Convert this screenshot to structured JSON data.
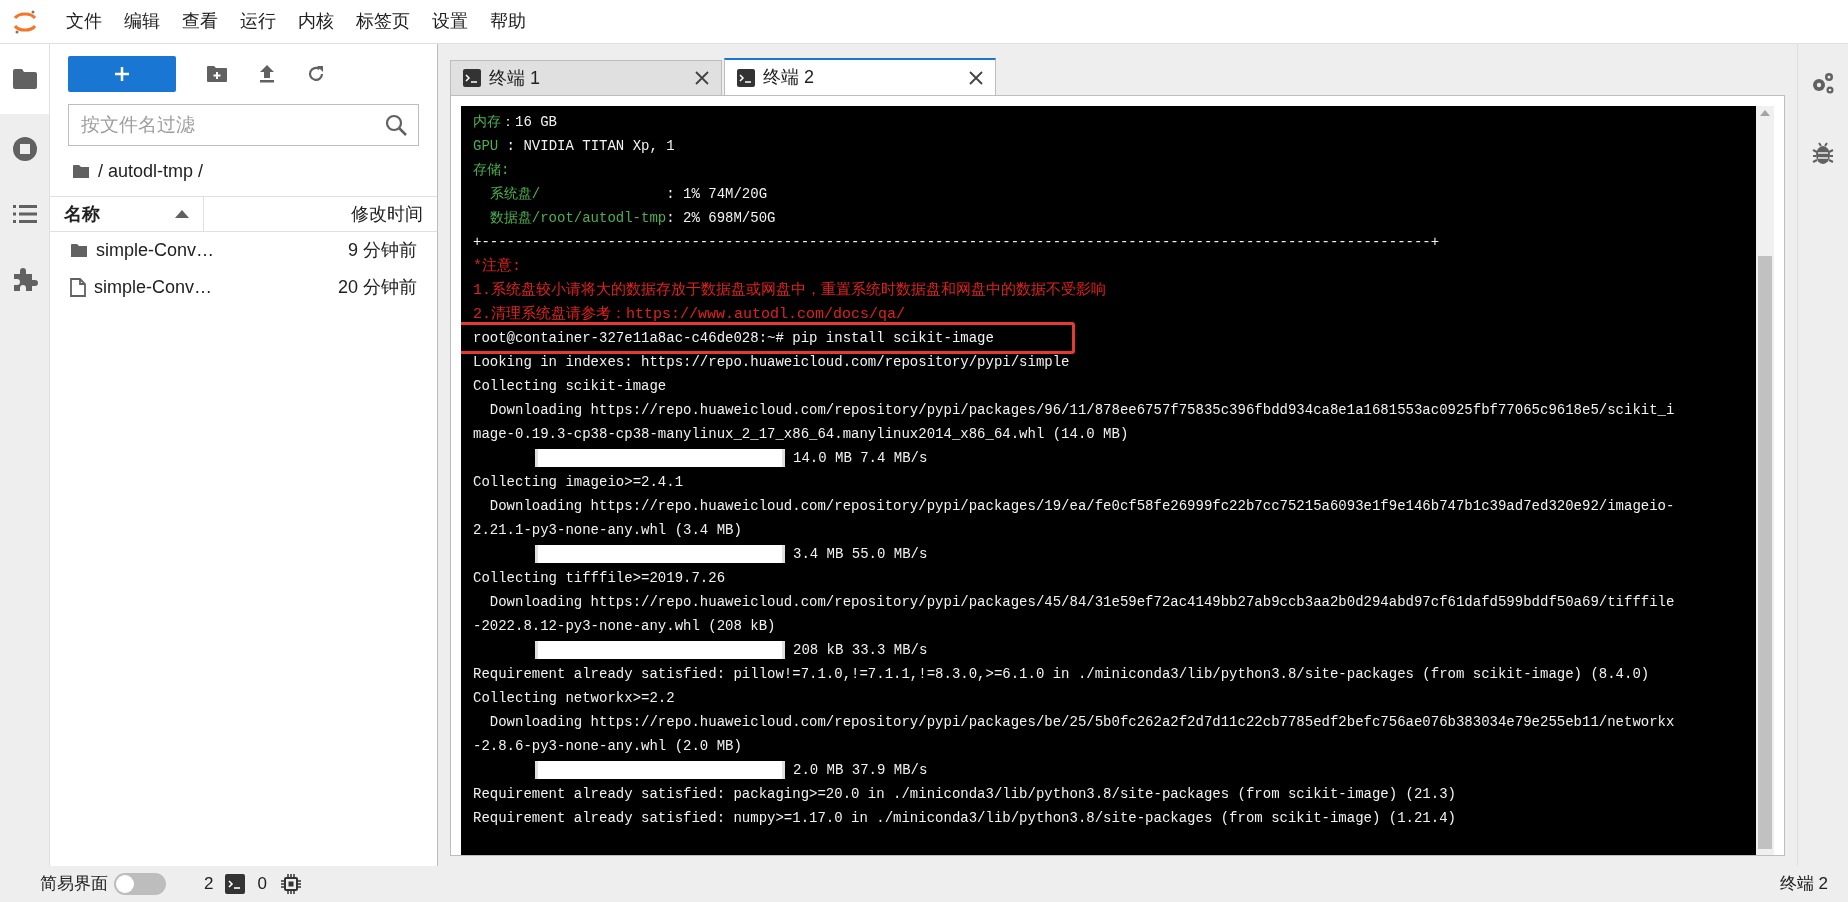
{
  "menu": [
    "文件",
    "编辑",
    "查看",
    "运行",
    "内核",
    "标签页",
    "设置",
    "帮助"
  ],
  "file_browser": {
    "filter_placeholder": "按文件名过滤",
    "path": "/ autodl-tmp /",
    "columns": [
      {
        "label": "名称",
        "sorted": true
      },
      {
        "label": "修改时间",
        "sorted": false
      }
    ],
    "files": [
      {
        "kind": "folder",
        "name": "simple-Conv…",
        "modified": "9 分钟前"
      },
      {
        "kind": "file",
        "name": "simple-Conv…",
        "modified": "20 分钟前"
      }
    ]
  },
  "tabs": [
    {
      "label": "终端 1",
      "selected": false
    },
    {
      "label": "终端 2",
      "selected": true
    }
  ],
  "terminal": {
    "lines": [
      {
        "kind": "kv",
        "label": "内存",
        "text": "：16 GB"
      },
      {
        "kind": "kv",
        "label": "GPU",
        "text": " : NVIDIA TITAN Xp, 1"
      },
      {
        "kind": "kv",
        "label": "存储:"
      },
      {
        "kind": "kv",
        "label": "  系统盘/",
        "text": "               : 1% 74M/20G"
      },
      {
        "kind": "kv",
        "label": "  数据盘/root/autodl-tmp",
        "text": ": 2% 698M/50G"
      },
      {
        "kind": "plain",
        "text": "+-----------------------------------------------------------------------------------------------------------------+"
      },
      {
        "kind": "warn",
        "text": "*注意:"
      },
      {
        "kind": "warn",
        "text": "1.系统盘较小请将大的数据存放于数据盘或网盘中，重置系统时数据盘和网盘中的数据不受影响"
      },
      {
        "kind": "warn",
        "text": "2.清理系统盘请参考：https://www.autodl.com/docs/qa/"
      },
      {
        "kind": "command",
        "text": "root@container-327e11a8ac-c46de028:~# pip install scikit-image"
      },
      {
        "kind": "plain",
        "text": "Looking in indexes: https://repo.huaweicloud.com/repository/pypi/simple"
      },
      {
        "kind": "plain",
        "text": "Collecting scikit-image"
      },
      {
        "kind": "plain",
        "text": "  Downloading https://repo.huaweicloud.com/repository/pypi/packages/96/11/878ee6757f75835c396fbdd934ca8e1a1681553ac0925fbf77065c9618e5/scikit_i"
      },
      {
        "kind": "plain",
        "text": "mage-0.19.3-cp38-cp38-manylinux_2_17_x86_64.manylinux2014_x86_64.whl (14.0 MB)"
      },
      {
        "kind": "progress",
        "level": 1,
        "text": "14.0 MB 7.4 MB/s"
      },
      {
        "kind": "plain",
        "text": "Collecting imageio>=2.4.1"
      },
      {
        "kind": "plain",
        "text": "  Downloading https://repo.huaweicloud.com/repository/pypi/packages/19/ea/fe0cf58fe26999fc22b7cc75215a6093e1f9e146b747b1c39ad7ed320e92/imageio-"
      },
      {
        "kind": "plain",
        "text": "2.21.1-py3-none-any.whl (3.4 MB)"
      },
      {
        "kind": "progress",
        "level": 1,
        "text": "3.4 MB 55.0 MB/s"
      },
      {
        "kind": "plain",
        "text": "Collecting tifffile>=2019.7.26"
      },
      {
        "kind": "plain",
        "text": "  Downloading https://repo.huaweicloud.com/repository/pypi/packages/45/84/31e59ef72ac4149bb27ab9ccb3aa2b0d294abd97cf61dafd599bddf50a69/tifffile"
      },
      {
        "kind": "plain",
        "text": "-2022.8.12-py3-none-any.whl (208 kB)"
      },
      {
        "kind": "progress",
        "level": 1,
        "text": "208 kB 33.3 MB/s"
      },
      {
        "kind": "plain",
        "text": "Requirement already satisfied: pillow!=7.1.0,!=7.1.1,!=8.3.0,>=6.1.0 in ./miniconda3/lib/python3.8/site-packages (from scikit-image) (8.4.0)"
      },
      {
        "kind": "plain",
        "text": "Collecting networkx>=2.2"
      },
      {
        "kind": "plain",
        "text": "  Downloading https://repo.huaweicloud.com/repository/pypi/packages/be/25/5b0fc262a2f2d7d11c22cb7785edf2befc756ae076b383034e79e255eb11/networkx"
      },
      {
        "kind": "plain",
        "text": "-2.8.6-py3-none-any.whl (2.0 MB)"
      },
      {
        "kind": "progress",
        "level": 1,
        "text": "2.0 MB 37.9 MB/s"
      },
      {
        "kind": "plain",
        "text": "Requirement already satisfied: packaging>=20.0 in ./miniconda3/lib/python3.8/site-packages (from scikit-image) (21.3)"
      },
      {
        "kind": "plain",
        "text": "Requirement already satisfied: numpy>=1.17.0 in ./miniconda3/lib/python3.8/site-packages (from scikit-image) (1.21.4)"
      }
    ]
  },
  "status_bar": {
    "simple_mode_label": "简易界面",
    "simple_mode_on": false,
    "terminal_count": "2",
    "kernel_count": "0",
    "active_tab": "终端 2"
  }
}
